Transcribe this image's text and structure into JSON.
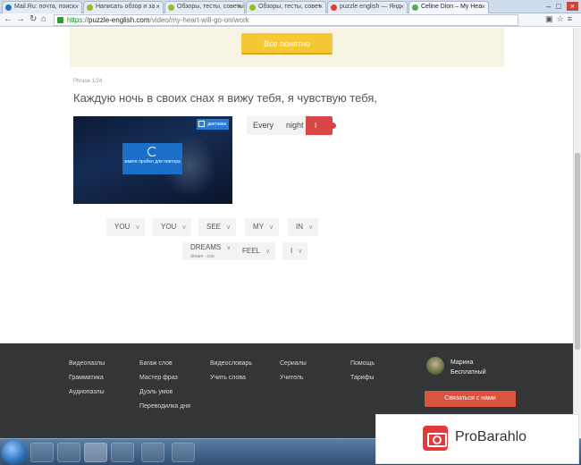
{
  "browser": {
    "tabs": [
      {
        "label": "Mail.Ru: почта, поиск",
        "fav": "#2b6ec6"
      },
      {
        "label": "Написать обзор и за",
        "fav": "#8fbf2a"
      },
      {
        "label": "Обзоры, тесты, советы",
        "fav": "#8fbf2a"
      },
      {
        "label": "Обзоры, тесты, совет",
        "fav": "#8fbf2a"
      },
      {
        "label": "puzzle english — Янд",
        "fav": "#e03b2d"
      },
      {
        "label": "Celine Dion – My Hea",
        "fav": "#4caf50",
        "active": true
      }
    ],
    "url_scheme": "https://",
    "url_host": "puzzle-english.com",
    "url_path": "/video/my-heart-will-go-on/work"
  },
  "banner": {
    "button_label": "Все понятно"
  },
  "exercise": {
    "phrase_counter": "Phrase 1/24",
    "phrase_text": "Каждую ночь в своих снах я вижу тебя, я чувствую тебя,",
    "video": {
      "dict_label": "диктовка",
      "play_hint": "жмите пробел для повтора"
    },
    "answer_words": [
      "Every",
      "night"
    ],
    "cursor_word": "I",
    "options_row1": [
      "YOU",
      "YOU",
      "SEE",
      "MY",
      "IN"
    ],
    "options_row2": [
      {
        "word": "DREAMS",
        "hint": "dream - сон"
      },
      {
        "word": "FEEL"
      },
      {
        "word": "I"
      }
    ]
  },
  "footer": {
    "col1": [
      "Видеопазлы",
      "Грамматика",
      "Аудиопазлы"
    ],
    "col2": [
      "Багаж слов",
      "Мастер фраз",
      "Дуэль умов",
      "Переводилка дня"
    ],
    "col3": [
      "Видеословарь",
      "Учить слова"
    ],
    "col4": [
      "Сериалы",
      "Учитель"
    ],
    "col5": [
      "Помощь",
      "Тарифы"
    ],
    "user_name": "Марина",
    "user_plan": "Бесплатный",
    "contact_button": "Связаться с нами"
  },
  "watermark": {
    "text": "ProBarahlo"
  },
  "colors": {
    "accent_yellow": "#f7c836",
    "accent_red": "#d84747",
    "footer_bg": "#333537"
  }
}
